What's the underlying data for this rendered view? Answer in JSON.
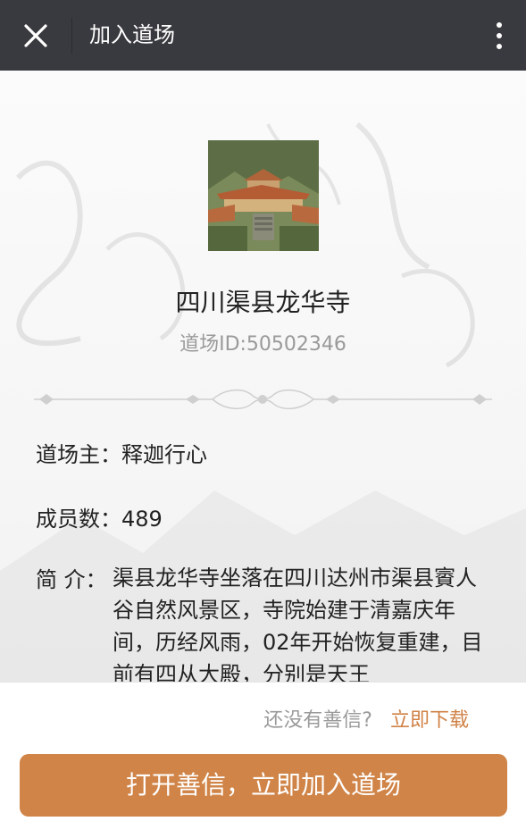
{
  "header": {
    "title": "加入道场",
    "close_icon": "close-icon",
    "more_icon": "more-vertical-icon"
  },
  "temple": {
    "name": "四川渠县龙华寺",
    "id_text": "道场ID:50502346"
  },
  "info": {
    "owner_label": "道场主：",
    "owner_value": "释迦行心",
    "members_label": "成员数：",
    "members_value": "489",
    "intro_label": "简 介：",
    "intro_text": "渠县龙华寺坐落在四川达州市渠县賨人谷自然风景区，寺院始建于清嘉庆年间，历经风雨，02年开始恢复重建，目前有四从大殿，分别是天王"
  },
  "footer": {
    "no_app_text": "还没有善信?",
    "download_link": "立即下载",
    "cta_button": "打开善信，立即加入道场"
  },
  "colors": {
    "header_bg": "#393a3f",
    "accent": "#d08447",
    "link": "#d08247"
  }
}
